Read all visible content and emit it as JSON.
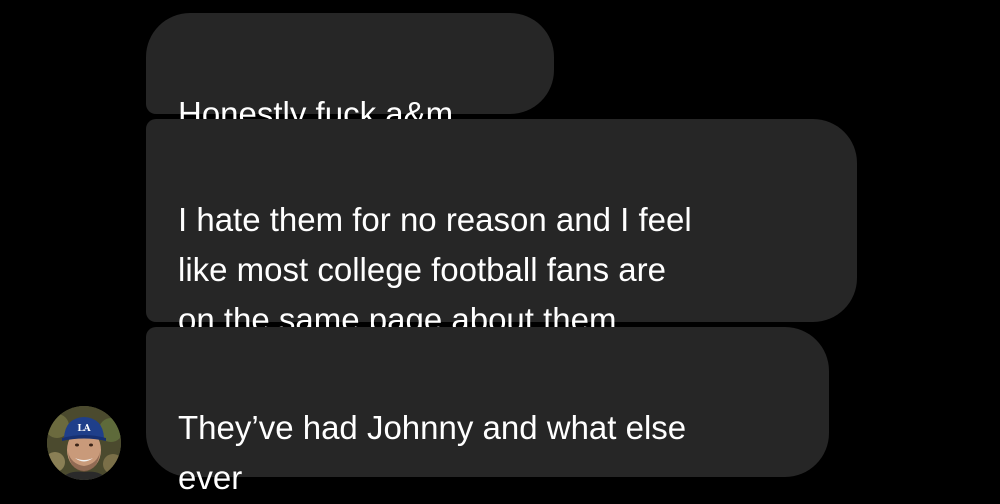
{
  "conversation": {
    "messages": [
      {
        "text": "Honestly fuck a&m"
      },
      {
        "text": "I hate them for no reason and I feel\nlike most college football fans are\non the same page about them"
      },
      {
        "text": "They’ve had Johnny and what else\never"
      }
    ],
    "sender_avatar": {
      "icon": "profile-photo",
      "cap_logo": "LA"
    }
  },
  "colors": {
    "background": "#000000",
    "bubble": "#262626",
    "text": "#ffffff"
  }
}
